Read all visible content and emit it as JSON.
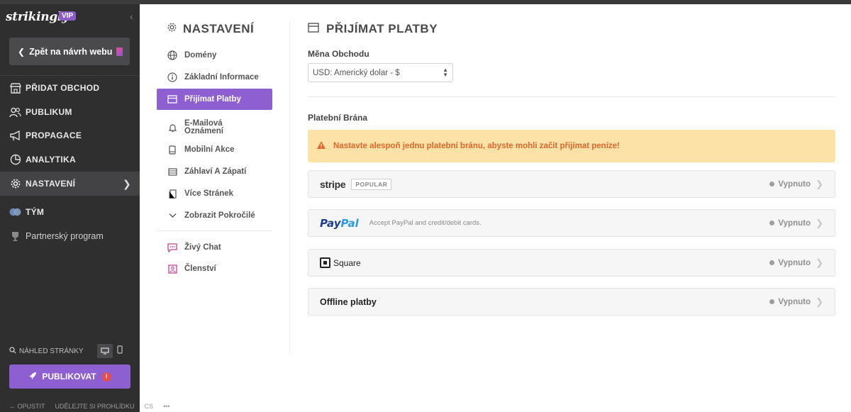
{
  "brand": {
    "name": "strikingly",
    "badge": "VIP"
  },
  "sidebar": {
    "back_label": "Zpět na návrh webu",
    "items": [
      {
        "label": "PŘIDAT OBCHOD",
        "icon": "store-icon"
      },
      {
        "label": "PUBLIKUM",
        "icon": "users-icon"
      },
      {
        "label": "PROPAGACE",
        "icon": "megaphone-icon"
      },
      {
        "label": "ANALYTIKA",
        "icon": "chart-icon"
      },
      {
        "label": "NASTAVENÍ",
        "icon": "gear-icon"
      },
      {
        "label": "TÝM",
        "icon": "team-icon"
      },
      {
        "label": "Partnerský program",
        "icon": "trophy-icon"
      }
    ],
    "active_item": "NASTAVENÍ",
    "preview_label": "NÁHLED STRÁNKY",
    "publish_label": "PUBLIKOVAT",
    "footer": {
      "exit": "OPUSTIT",
      "feedback": "UDĚLEJTE SI PROHLÍDKU",
      "lang": "CS",
      "more": "•••"
    }
  },
  "settings_nav": {
    "title": "NASTAVENÍ",
    "items": [
      {
        "label": "Domény",
        "icon": "globe-icon"
      },
      {
        "label": "Základní Informace",
        "icon": "info-icon"
      },
      {
        "label": "Přijímat Platby",
        "icon": "payment-card-icon"
      },
      {
        "label": "E-Mailová Oznámení",
        "icon": "bell-icon"
      },
      {
        "label": "Mobilní Akce",
        "icon": "mobile-icon"
      },
      {
        "label": "Záhlaví A Zápatí",
        "icon": "header-footer-icon"
      },
      {
        "label": "Více Stránek",
        "icon": "pages-icon"
      },
      {
        "label": "Zobrazit Pokročilé",
        "icon": "chevron-down-icon"
      },
      {
        "label": "Živý Chat",
        "icon": "chat-icon"
      },
      {
        "label": "Členství",
        "icon": "membership-icon"
      }
    ],
    "active_item": "Přijímat Platby"
  },
  "main": {
    "title": "PŘIJÍMAT PLATBY",
    "currency_label": "Měna Obchodu",
    "currency_value": "USD: Americký dolar - $",
    "gateway_label": "Platební Brána",
    "alert": "Nastavte alespoň jednu platební bránu, abyste mohli začít přijímat peníze!",
    "gateways": [
      {
        "name": "stripe",
        "badge": "POPULAR",
        "status": "Vypnuto"
      },
      {
        "name_part1": "Pay",
        "name_part2": "Pal",
        "description": "Accept PayPal and credit/debit cards.",
        "status": "Vypnuto"
      },
      {
        "name": "Square",
        "status": "Vypnuto"
      },
      {
        "name": "Offline platby",
        "status": "Vypnuto"
      }
    ]
  },
  "colors": {
    "sidebar_bg": "#2f2f30",
    "accent": "#8e5fd0",
    "alert_bg": "#fde2a7",
    "alert_text": "#e0672a"
  }
}
